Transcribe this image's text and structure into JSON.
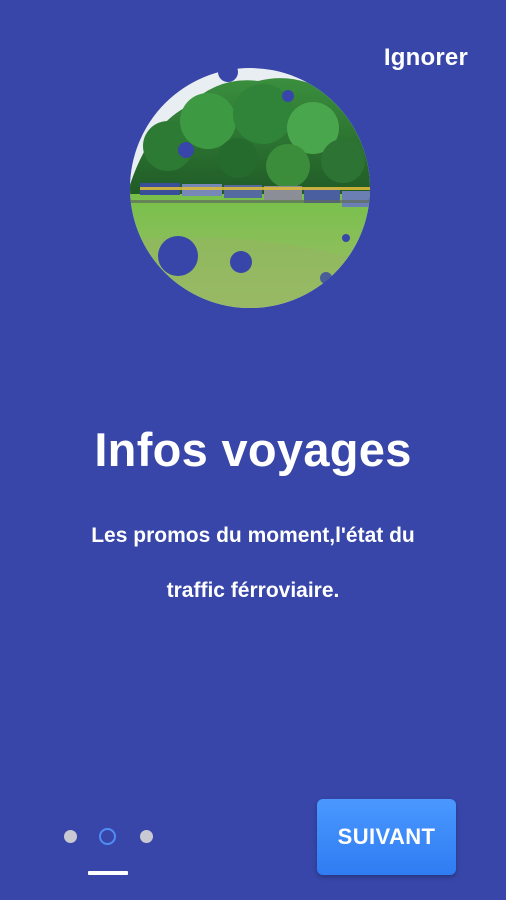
{
  "header": {
    "skip_label": "Ignorer"
  },
  "slide": {
    "title": "Infos voyages",
    "description_line1": "Les promos du moment,l'état du",
    "description_line2": "traffic férroviaire."
  },
  "pager": {
    "pages": 3,
    "active_index": 2
  },
  "footer": {
    "next_label": "SUIVANT"
  },
  "colors": {
    "background": "#3746a8",
    "accent": "#2f7cf3",
    "active_dot": "#4f8df5",
    "inactive_dot": "#c9c9d3"
  },
  "icons": {
    "hero": "train-landscape-image"
  }
}
